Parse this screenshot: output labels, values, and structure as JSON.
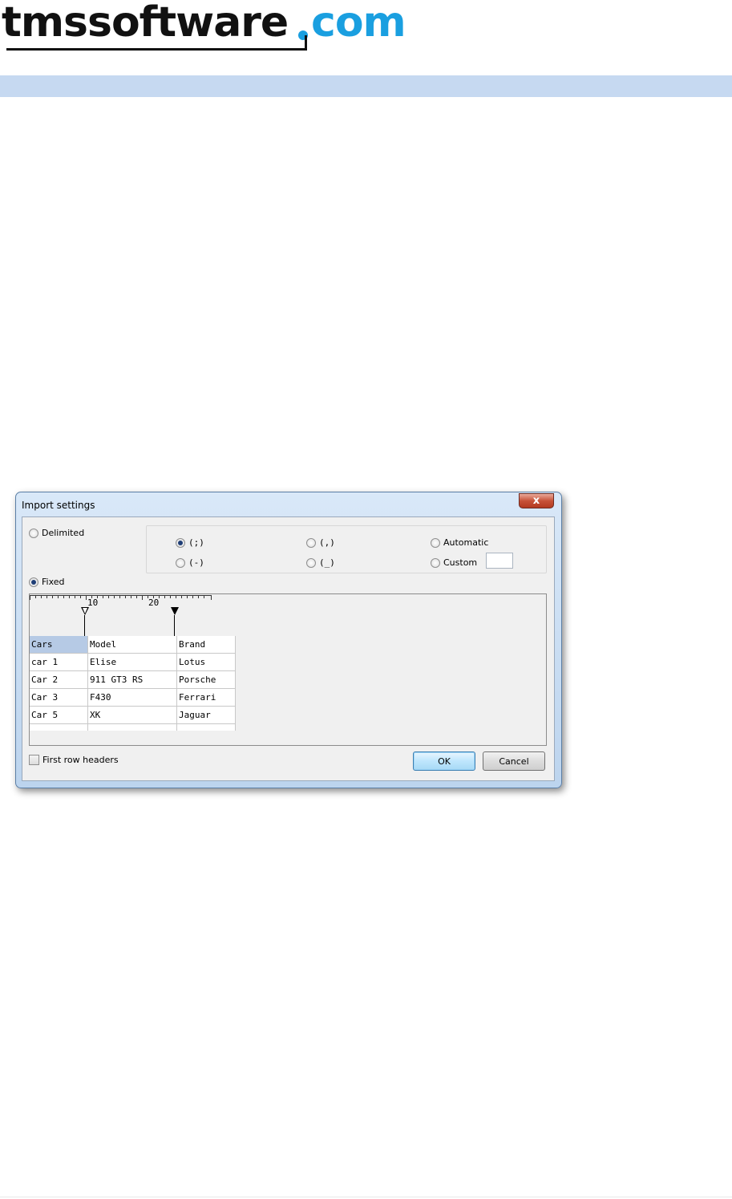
{
  "header": {
    "logo_main": "tmssoftware",
    "logo_domain": "com"
  },
  "dialog": {
    "title": "Import settings",
    "close_glyph": "x",
    "delimited_label": "Delimited",
    "delimited_checked": false,
    "delimiters": [
      {
        "label": "(;)",
        "checked": true
      },
      {
        "label": "(,)",
        "checked": false
      },
      {
        "label": "Automatic",
        "checked": false
      },
      {
        "label": "(-)",
        "checked": false
      },
      {
        "label": "(_)",
        "checked": false
      },
      {
        "label": "Custom",
        "checked": false
      }
    ],
    "custom_value": "",
    "fixed_label": "Fixed",
    "fixed_checked": true,
    "ruler": {
      "labels": [
        "10",
        "20"
      ]
    },
    "grid": {
      "rows": [
        [
          "Cars",
          "Model",
          "Brand"
        ],
        [
          "car 1",
          "Elise",
          "Lotus"
        ],
        [
          "Car 2",
          "911 GT3 RS",
          "Porsche"
        ],
        [
          "Car 3",
          "F430",
          "Ferrari"
        ],
        [
          "Car 5",
          "XK",
          "Jaguar"
        ]
      ]
    },
    "first_row_headers_label": "First row headers",
    "first_row_headers_checked": false,
    "ok_label": "OK",
    "cancel_label": "Cancel"
  },
  "colors": {
    "header_band": "#c6d9f1",
    "logo_accent": "#1a9fe0",
    "selected_cell": "#b6cae5"
  },
  "icons": [
    "close-icon",
    "radio-icon",
    "checkbox-icon",
    "column-marker-icon"
  ]
}
